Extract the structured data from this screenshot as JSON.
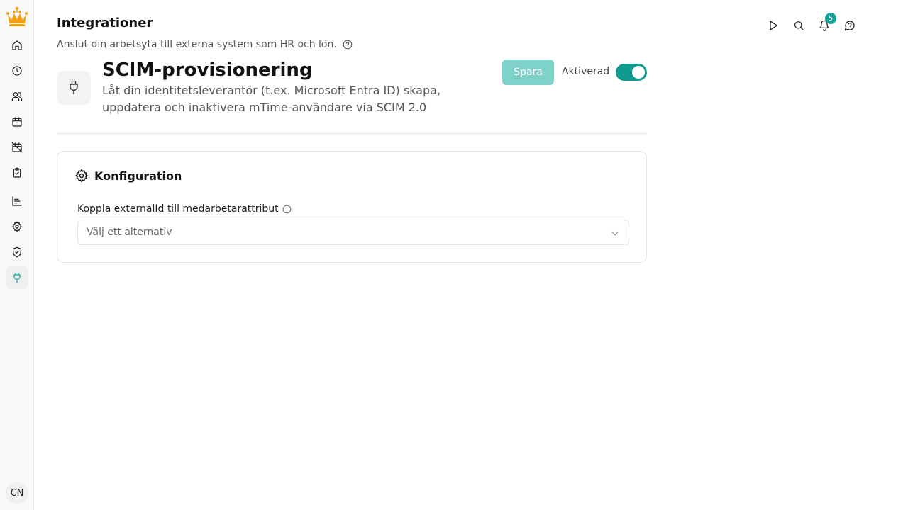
{
  "sidebar": {
    "items": [
      {
        "icon": "home-icon"
      },
      {
        "icon": "clock-icon"
      },
      {
        "icon": "users-icon"
      },
      {
        "icon": "calendar-icon"
      },
      {
        "icon": "calendar-off-icon"
      },
      {
        "icon": "clipboard-check-icon"
      },
      {
        "icon": "chart-icon"
      },
      {
        "icon": "gear-icon"
      },
      {
        "icon": "shield-check-icon"
      },
      {
        "icon": "plug-icon",
        "active": true
      }
    ],
    "avatar_initials": "CN",
    "logo_color": "#f4a012"
  },
  "header": {
    "title": "Integrationer",
    "subtitle": "Anslut din arbetsyta till externa system som HR och lön."
  },
  "topbar": {
    "notifications_count": "5"
  },
  "integration": {
    "title": "SCIM-provisionering",
    "description": "Låt din identitetsleverantör (t.ex. Microsoft Entra ID) skapa, uppdatera och inaktivera mTime-användare via SCIM 2.0",
    "save_label": "Spara",
    "toggle_label": "Aktiverad",
    "enabled": true
  },
  "config": {
    "title": "Konfiguration",
    "field_label": "Koppla externalId till medarbetarattribut",
    "select_placeholder": "Välj ett alternativ"
  },
  "colors": {
    "accent": "#0f9c8e",
    "accent_light": "#7fd2c9"
  }
}
